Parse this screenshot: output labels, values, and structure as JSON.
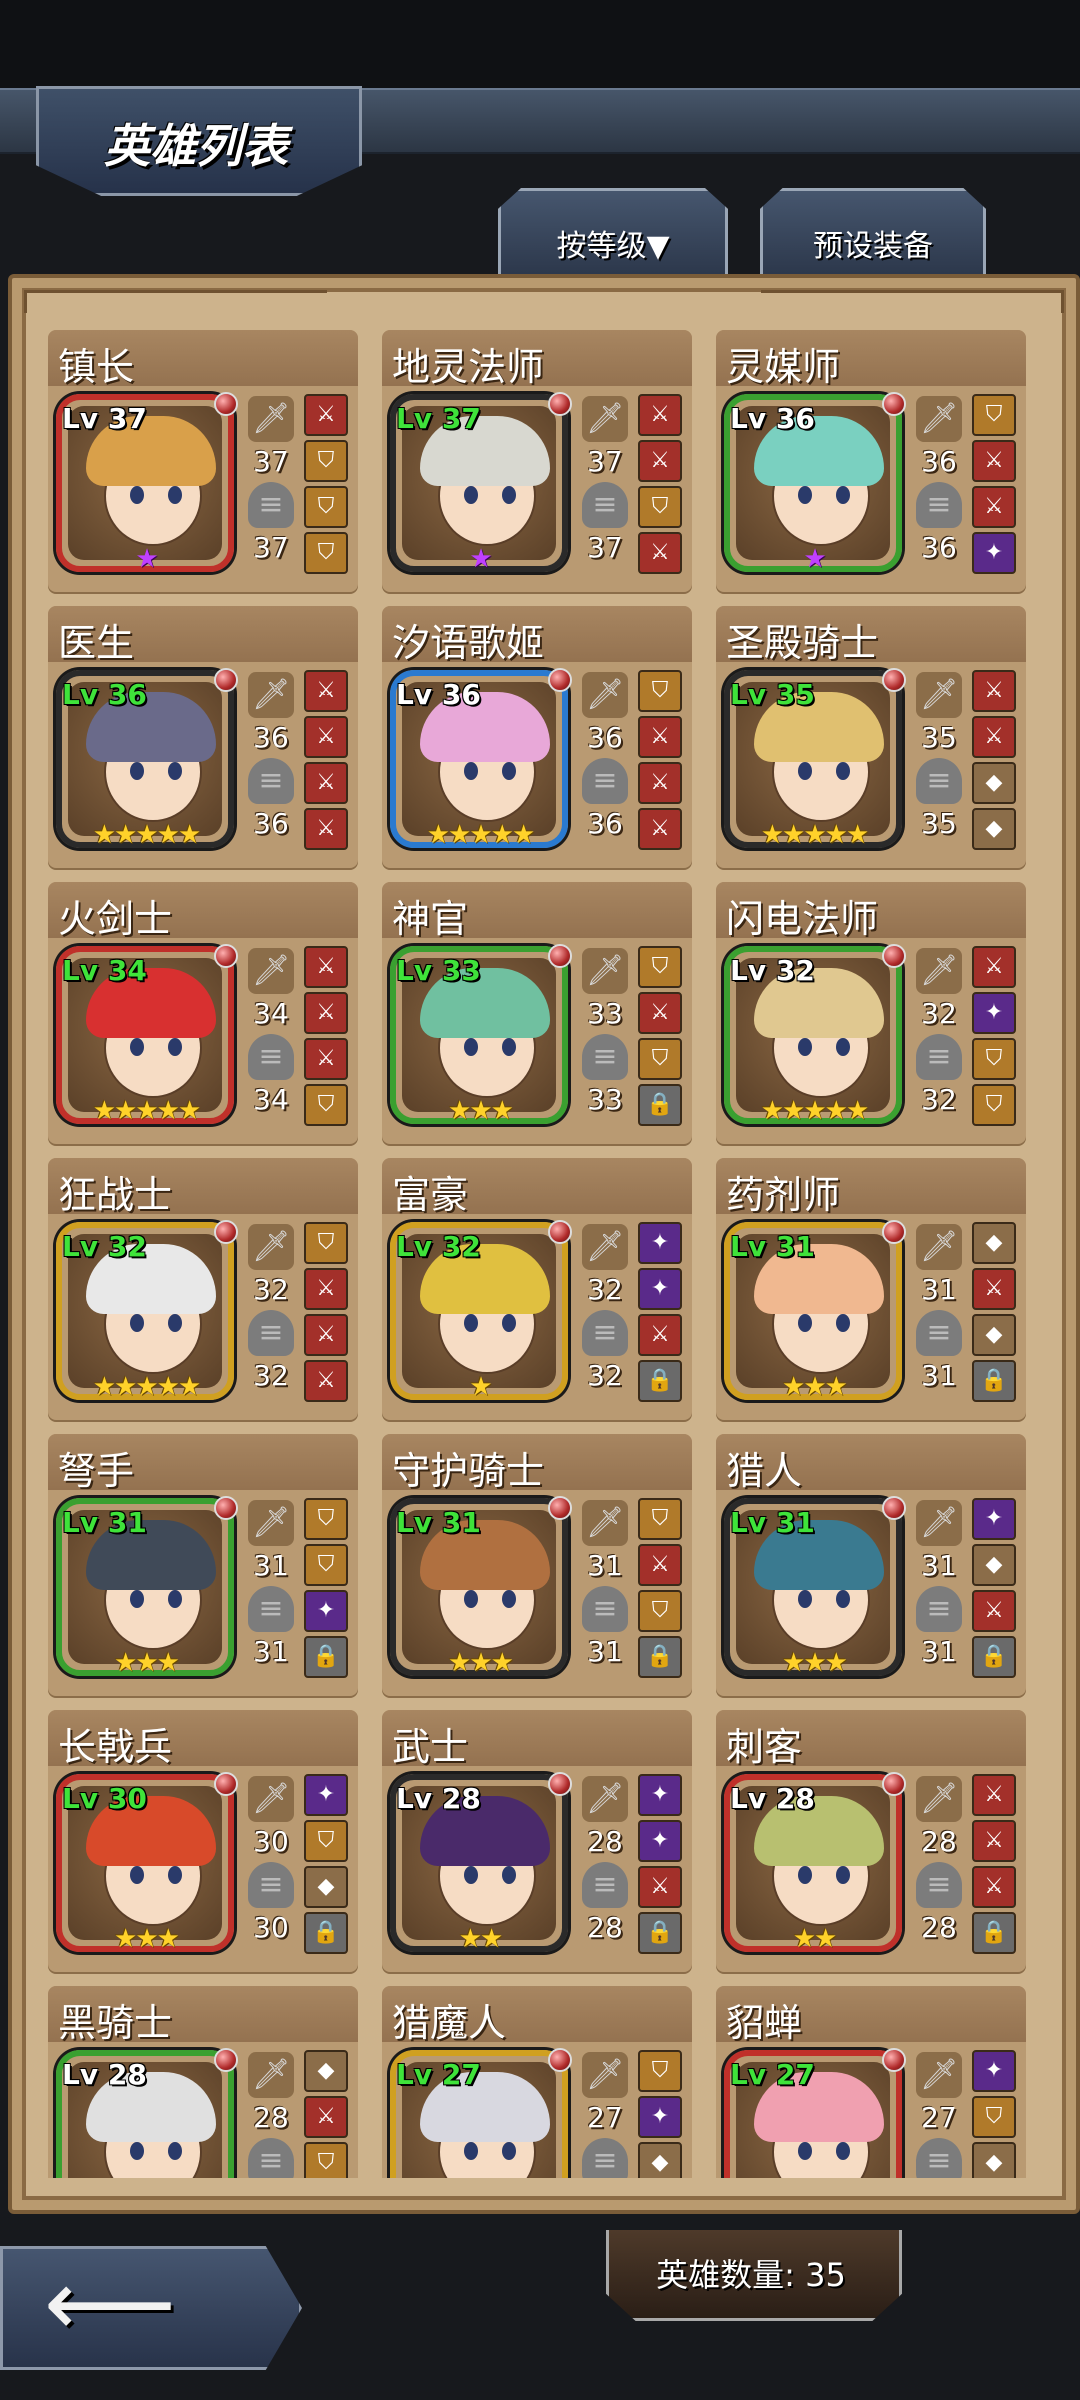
{
  "header": {
    "title": "英雄列表"
  },
  "tabs": {
    "sort_label": "按等级▼",
    "preset_label": "预设装备"
  },
  "footer": {
    "hero_count": "英雄数量: 35",
    "back_icon": "back-arrow-icon"
  },
  "colors": {
    "panel": "#cdb38c",
    "level_green": "#3fe33a",
    "star_gold": "#ffd22a",
    "star_purple": "#c040ff"
  },
  "heroes": [
    {
      "name": "镇长",
      "level": "Lv 37",
      "weapon": "37",
      "armor": "37",
      "stars": "★",
      "star_color": "purple",
      "lv_color": "white",
      "frame": "#c0302a",
      "hair": "#d9a04a",
      "slots": [
        "red",
        "gold",
        "gold",
        "gold"
      ]
    },
    {
      "name": "地灵法师",
      "level": "Lv 37",
      "weapon": "37",
      "armor": "37",
      "stars": "★",
      "star_color": "purple",
      "lv_color": "green",
      "frame": "#2a2a2a",
      "hair": "#d8d8d0",
      "slots": [
        "red",
        "red",
        "gold",
        "red"
      ]
    },
    {
      "name": "灵媒师",
      "level": "Lv 36",
      "weapon": "36",
      "armor": "36",
      "stars": "★",
      "star_color": "purple",
      "lv_color": "white",
      "frame": "#3aa030",
      "hair": "#7ad0c0",
      "slots": [
        "gold",
        "red",
        "red",
        "purple"
      ]
    },
    {
      "name": "医生",
      "level": "Lv 36",
      "weapon": "36",
      "armor": "36",
      "stars": "★★★★★",
      "star_color": "gold",
      "lv_color": "green",
      "frame": "#2a2a2a",
      "hair": "#6a6a8a",
      "slots": [
        "red",
        "red",
        "red",
        "red"
      ]
    },
    {
      "name": "汐语歌姬",
      "level": "Lv 36",
      "weapon": "36",
      "armor": "36",
      "stars": "★★★★★",
      "star_color": "gold",
      "lv_color": "white",
      "frame": "#2a7ad0",
      "hair": "#e8a8d8",
      "slots": [
        "gold",
        "red",
        "red",
        "red"
      ]
    },
    {
      "name": "圣殿骑士",
      "level": "Lv 35",
      "weapon": "35",
      "armor": "35",
      "stars": "★★★★★",
      "star_color": "gold",
      "lv_color": "green",
      "frame": "#2a2a2a",
      "hair": "#e0c070",
      "slots": [
        "red",
        "red",
        "empty",
        "empty"
      ]
    },
    {
      "name": "火剑士",
      "level": "Lv 34",
      "weapon": "34",
      "armor": "34",
      "stars": "★★★★★",
      "star_color": "gold",
      "lv_color": "green",
      "frame": "#c0302a",
      "hair": "#d83030",
      "slots": [
        "red",
        "red",
        "red",
        "gold"
      ]
    },
    {
      "name": "神官",
      "level": "Lv 33",
      "weapon": "33",
      "armor": "33",
      "stars": "★★★",
      "star_color": "gold",
      "lv_color": "green",
      "frame": "#3aa030",
      "hair": "#70c0a0",
      "slots": [
        "gold",
        "red",
        "gold",
        "lock"
      ]
    },
    {
      "name": "闪电法师",
      "level": "Lv 32",
      "weapon": "32",
      "armor": "32",
      "stars": "★★★★★",
      "star_color": "gold",
      "lv_color": "white",
      "frame": "#3aa030",
      "hair": "#e0c890",
      "slots": [
        "red",
        "purple",
        "gold",
        "gold"
      ]
    },
    {
      "name": "狂战士",
      "level": "Lv 32",
      "weapon": "32",
      "armor": "32",
      "stars": "★★★★★",
      "star_color": "gold",
      "lv_color": "green",
      "frame": "#d0a020",
      "hair": "#e8e8e8",
      "slots": [
        "gold",
        "red",
        "red",
        "red"
      ]
    },
    {
      "name": "富豪",
      "level": "Lv 32",
      "weapon": "32",
      "armor": "32",
      "stars": "★",
      "star_color": "gold",
      "lv_color": "green",
      "frame": "#d0a020",
      "hair": "#e0c040",
      "slots": [
        "purple",
        "purple",
        "red",
        "lock"
      ]
    },
    {
      "name": "药剂师",
      "level": "Lv 31",
      "weapon": "31",
      "armor": "31",
      "stars": "★★★",
      "star_color": "gold",
      "lv_color": "green",
      "frame": "#d0a020",
      "hair": "#f0b890",
      "slots": [
        "empty",
        "red",
        "empty",
        "lock"
      ]
    },
    {
      "name": "弩手",
      "level": "Lv 31",
      "weapon": "31",
      "armor": "31",
      "stars": "★★★",
      "star_color": "gold",
      "lv_color": "green",
      "frame": "#3aa030",
      "hair": "#404a58",
      "slots": [
        "gold",
        "gold",
        "purple",
        "lock"
      ]
    },
    {
      "name": "守护骑士",
      "level": "Lv 31",
      "weapon": "31",
      "armor": "31",
      "stars": "★★★",
      "star_color": "gold",
      "lv_color": "green",
      "frame": "#2a2a2a",
      "hair": "#b07040",
      "slots": [
        "gold",
        "red",
        "gold",
        "lock"
      ]
    },
    {
      "name": "猎人",
      "level": "Lv 31",
      "weapon": "31",
      "armor": "31",
      "stars": "★★★",
      "star_color": "gold",
      "lv_color": "green",
      "frame": "#2a2a2a",
      "hair": "#3a7a90",
      "slots": [
        "purple",
        "empty",
        "red",
        "lock"
      ]
    },
    {
      "name": "长戟兵",
      "level": "Lv 30",
      "weapon": "30",
      "armor": "30",
      "stars": "★★★",
      "star_color": "gold",
      "lv_color": "green",
      "frame": "#c0302a",
      "hair": "#d84a2a",
      "slots": [
        "purple",
        "gold",
        "empty",
        "lock"
      ]
    },
    {
      "name": "武士",
      "level": "Lv 28",
      "weapon": "28",
      "armor": "28",
      "stars": "★★",
      "star_color": "gold",
      "lv_color": "white",
      "frame": "#2a2a2a",
      "hair": "#4a2a6a",
      "slots": [
        "purple",
        "purple",
        "red",
        "lock"
      ]
    },
    {
      "name": "刺客",
      "level": "Lv 28",
      "weapon": "28",
      "armor": "28",
      "stars": "★★",
      "star_color": "gold",
      "lv_color": "white",
      "frame": "#c0302a",
      "hair": "#b8c070",
      "slots": [
        "red",
        "red",
        "red",
        "lock"
      ]
    },
    {
      "name": "黑骑士",
      "level": "Lv 28",
      "weapon": "28",
      "armor": "",
      "stars": "",
      "star_color": "gold",
      "lv_color": "white",
      "frame": "#3aa030",
      "hair": "#e0e0e0",
      "slots": [
        "empty",
        "red",
        "gold"
      ]
    },
    {
      "name": "猎魔人",
      "level": "Lv 27",
      "weapon": "27",
      "armor": "",
      "stars": "",
      "star_color": "gold",
      "lv_color": "green",
      "frame": "#d0a020",
      "hair": "#d8d8e0",
      "slots": [
        "gold",
        "purple",
        "empty"
      ]
    },
    {
      "name": "貂蝉",
      "level": "Lv 27",
      "weapon": "27",
      "armor": "",
      "stars": "",
      "star_color": "gold",
      "lv_color": "green",
      "frame": "#c0302a",
      "hair": "#f0a0b0",
      "slots": [
        "purple",
        "gold",
        "empty"
      ]
    }
  ]
}
